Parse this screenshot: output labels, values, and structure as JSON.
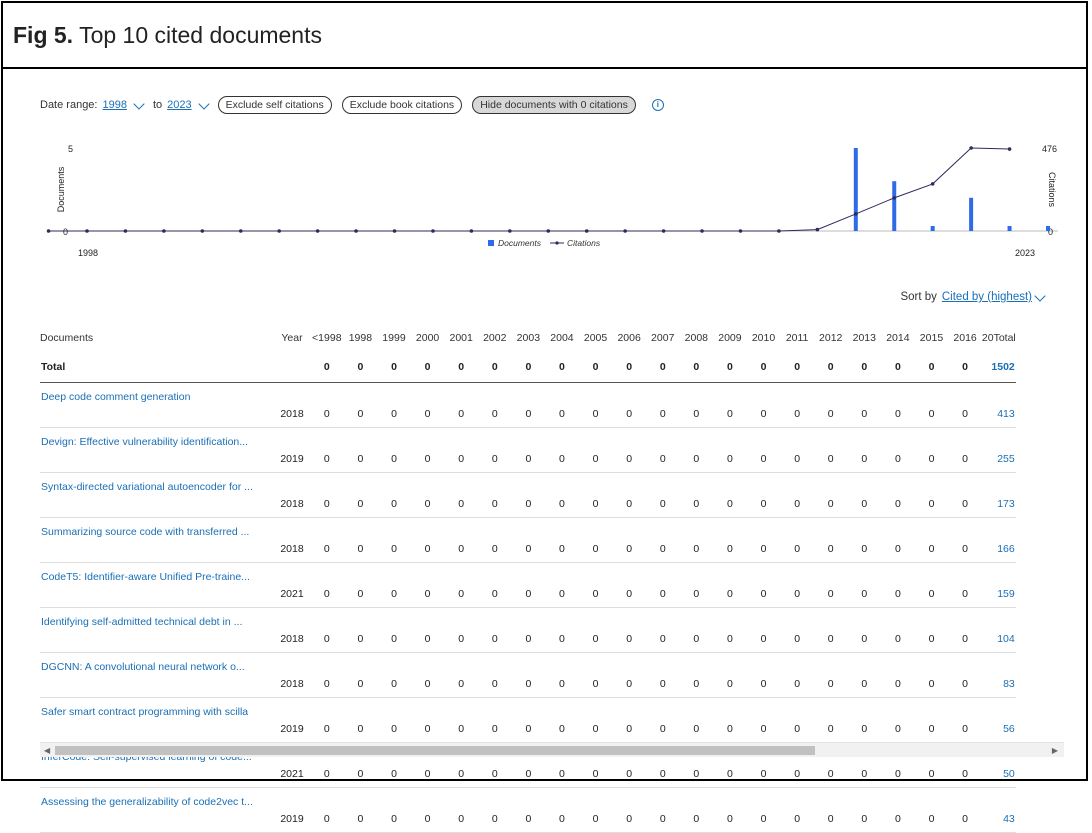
{
  "figure": {
    "number_label": "Fig 5.",
    "title": "Top 10 cited documents"
  },
  "controls": {
    "date_range_label": "Date range:",
    "from_year": "1998",
    "to_label": "to",
    "to_year": "2023",
    "exclude_self_label": "Exclude self citations",
    "exclude_book_label": "Exclude book citations",
    "hide_zero_label": "Hide documents with 0 citations",
    "info_icon": "info-icon"
  },
  "chart_data": {
    "type": "bar",
    "x": [
      1998,
      1999,
      2000,
      2001,
      2002,
      2003,
      2004,
      2005,
      2006,
      2007,
      2008,
      2009,
      2010,
      2011,
      2012,
      2013,
      2014,
      2015,
      2016,
      2017,
      2018,
      2019,
      2020,
      2021,
      2022,
      2023
    ],
    "series": [
      {
        "name": "Documents",
        "kind": "bar",
        "axis": "left",
        "color": "#2e6be6",
        "values": [
          0,
          0,
          0,
          0,
          0,
          0,
          0,
          0,
          0,
          0,
          0,
          0,
          0,
          0,
          0,
          0,
          0,
          0,
          0,
          0,
          5,
          3,
          0.3,
          2,
          0.3,
          0.3
        ]
      },
      {
        "name": "Citations",
        "kind": "line",
        "axis": "right",
        "color": "#2b2b5c",
        "values": [
          0,
          0,
          0,
          0,
          0,
          0,
          0,
          0,
          0,
          0,
          0,
          0,
          0,
          0,
          0,
          0,
          0,
          0,
          0,
          0,
          8,
          98,
          190,
          270,
          476,
          470
        ]
      }
    ],
    "xtick_start": "1998",
    "xtick_end": "2023",
    "ylabel_left": "Documents",
    "ylabel_right": "Citations",
    "ylim_left": [
      0,
      5
    ],
    "ylim_right": [
      0,
      476
    ],
    "ytick_left_top": "5",
    "ytick_left_bottom": "0",
    "ytick_right_top": "476",
    "ytick_right_bottom": "0",
    "legend_position": "bottom-center"
  },
  "sort": {
    "label": "Sort by",
    "value": "Cited by (highest)"
  },
  "table": {
    "doc_header": "Documents",
    "year_header": "Year",
    "year_columns": [
      "<1998",
      "1998",
      "1999",
      "2000",
      "2001",
      "2002",
      "2003",
      "2004",
      "2005",
      "2006",
      "2007",
      "2008",
      "2009",
      "2010",
      "2011",
      "2012",
      "2013",
      "2014",
      "2015",
      "2016"
    ],
    "truncated_column": "20",
    "total_header": "Total",
    "total_row": {
      "label": "Total",
      "values": [
        "0",
        "0",
        "0",
        "0",
        "0",
        "0",
        "0",
        "0",
        "0",
        "0",
        "0",
        "0",
        "0",
        "0",
        "0",
        "0",
        "0",
        "0",
        "0",
        "0"
      ],
      "total": "1502"
    },
    "rows": [
      {
        "title": "Deep code comment generation",
        "year": "2018",
        "total": "413"
      },
      {
        "title": "Devign: Effective vulnerability identification...",
        "year": "2019",
        "total": "255"
      },
      {
        "title": "Syntax-directed variational autoencoder for ...",
        "year": "2018",
        "total": "173"
      },
      {
        "title": "Summarizing source code with transferred ...",
        "year": "2018",
        "total": "166"
      },
      {
        "title": "CodeT5: Identifier-aware Unified Pre-traine...",
        "year": "2021",
        "total": "159"
      },
      {
        "title": "Identifying self-admitted technical debt in ...",
        "year": "2018",
        "total": "104"
      },
      {
        "title": "DGCNN: A convolutional neural network o...",
        "year": "2018",
        "total": "83"
      },
      {
        "title": "Safer smart contract programming with scilla",
        "year": "2019",
        "total": "56"
      },
      {
        "title": "InferCode: Self-supervised learning of code...",
        "year": "2021",
        "total": "50"
      },
      {
        "title": "Assessing the generalizability of code2vec t...",
        "year": "2019",
        "total": "43"
      }
    ],
    "cell_value": "0"
  },
  "scrollbar": {
    "left_arrow": "◀",
    "right_arrow": "▶"
  }
}
